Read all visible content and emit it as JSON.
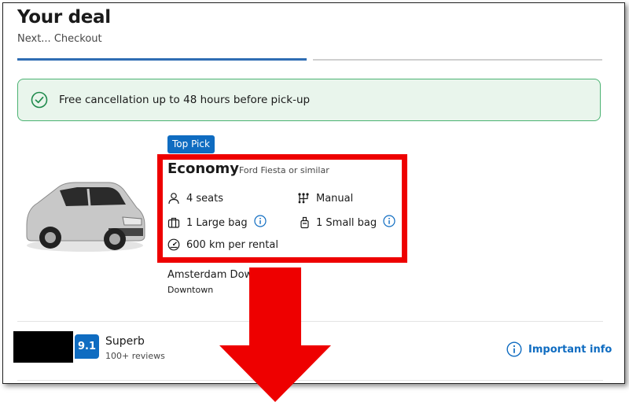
{
  "header": {
    "title": "Your deal",
    "subtitle": "Next... Checkout"
  },
  "notice": {
    "text": "Free cancellation up to 48 hours before pick-up",
    "color": "#4bb272"
  },
  "car": {
    "badge": "Top Pick",
    "class": "Economy",
    "model": "Ford Fiesta or similar",
    "specs": {
      "seats": "4 seats",
      "transmission": "Manual",
      "large_bag": "1 Large bag",
      "small_bag": "1 Small bag",
      "mileage": "600 km per rental"
    },
    "location": "Amsterdam Dow",
    "location_sub": "Downtown"
  },
  "supplier": {
    "score": "9.1",
    "rating_label": "Superb",
    "reviews": "100+ reviews"
  },
  "actions": {
    "important_info": "Important info"
  },
  "colors": {
    "accent": "#0f6cc1",
    "highlight": "#ee0000",
    "progress": "#2f6db3"
  }
}
